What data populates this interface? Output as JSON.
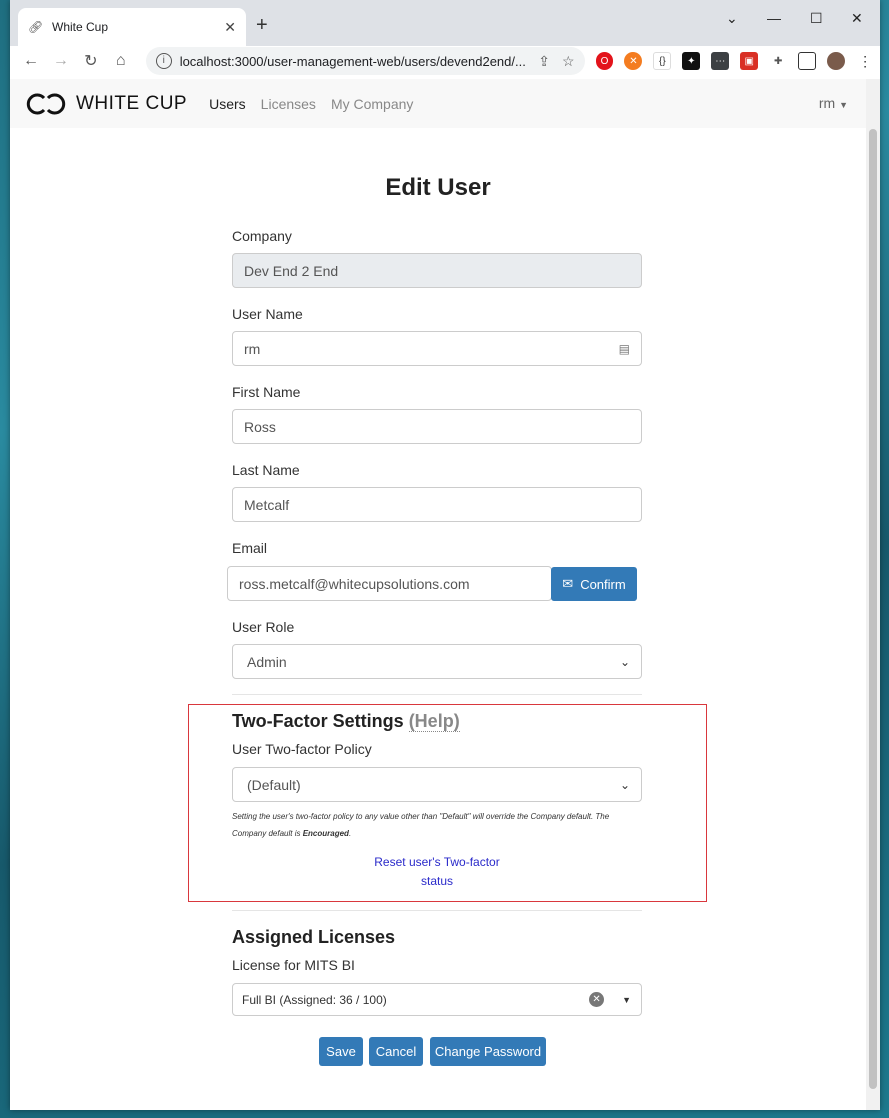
{
  "browser": {
    "tab_title": "White Cup",
    "url": "localhost:3000/user-management-web/users/devend2end/..."
  },
  "navbar": {
    "brand": "WHITE CUP",
    "links": [
      "Users",
      "Licenses",
      "My Company"
    ],
    "user": "rm"
  },
  "form": {
    "title": "Edit User",
    "company_label": "Company",
    "company_value": "Dev End 2 End",
    "username_label": "User Name",
    "username_value": "rm",
    "firstname_label": "First Name",
    "firstname_value": "Ross",
    "lastname_label": "Last Name",
    "lastname_value": "Metcalf",
    "email_label": "Email",
    "email_value": "ross.metcalf@whitecupsolutions.com",
    "confirm_label": "Confirm",
    "role_label": "User Role",
    "role_value": "Admin"
  },
  "two_factor": {
    "title": "Two-Factor Settings",
    "help": "(Help)",
    "policy_label": "User Two-factor Policy",
    "policy_value": "(Default)",
    "note_prefix": "Setting the user's two-factor policy to any value other than \"Default\" will override the Company default. The Company default is ",
    "note_default": "Encouraged",
    "note_suffix": ".",
    "reset_link": "Reset user's Two-factor status"
  },
  "licenses": {
    "title": "Assigned Licenses",
    "license_label": "License for MITS BI",
    "license_value": "Full BI (Assigned: 36 / 100)"
  },
  "buttons": {
    "save": "Save",
    "cancel": "Cancel",
    "change_password": "Change Password"
  }
}
